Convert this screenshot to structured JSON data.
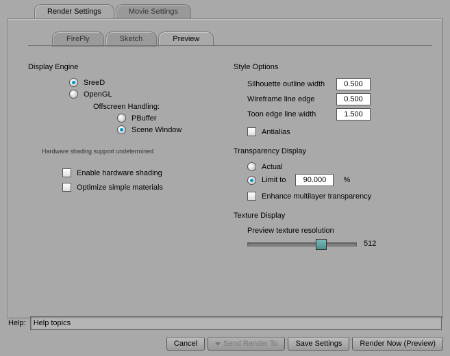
{
  "tabs": {
    "top": [
      "Render Settings",
      "Movie Settings"
    ],
    "top_active": 0,
    "sub": [
      "FireFly",
      "Sketch",
      "Preview"
    ],
    "sub_active": 2
  },
  "display_engine": {
    "title": "Display Engine",
    "options": [
      "SreeD",
      "OpenGL"
    ],
    "selected": 0,
    "offscreen_label": "Offscreen Handling:",
    "offscreen_options": [
      "PBuffer",
      "Scene Window"
    ],
    "offscreen_selected": 1,
    "status": "Hardware shading support undetermined",
    "enable_hw": "Enable hardware shading",
    "enable_hw_checked": false,
    "optimize": "Optimize simple materials",
    "optimize_checked": false
  },
  "style_options": {
    "title": "Style Options",
    "silhouette_label": "Silhouette outline width",
    "silhouette_value": "0.500",
    "wireframe_label": "Wireframe line edge",
    "wireframe_value": "0.500",
    "toon_label": "Toon edge line width",
    "toon_value": "1.500",
    "antialias_label": "Antialias",
    "antialias_checked": false
  },
  "transparency": {
    "title": "Transparency Display",
    "actual_label": "Actual",
    "limit_label": "Limit to",
    "limit_selected": 1,
    "limit_value": "90.000",
    "limit_suffix": "%",
    "enhance_label": "Enhance multilayer transparency",
    "enhance_checked": false
  },
  "texture": {
    "title": "Texture Display",
    "resolution_label": "Preview texture resolution",
    "resolution_value": "512"
  },
  "help": {
    "label": "Help:",
    "value": "Help topics"
  },
  "buttons": {
    "cancel": "Cancel",
    "send": "Send Render To",
    "save": "Save Settings",
    "render": "Render Now (Preview)"
  }
}
